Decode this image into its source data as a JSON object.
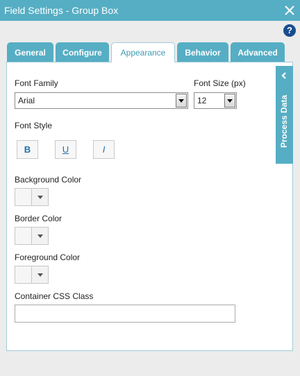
{
  "dialog": {
    "title": "Field Settings - Group Box",
    "close_icon": "close-icon",
    "help_icon": "help-icon",
    "help_glyph": "?"
  },
  "tabs": [
    {
      "label": "General",
      "active": false
    },
    {
      "label": "Configure",
      "active": false
    },
    {
      "label": "Appearance",
      "active": true
    },
    {
      "label": "Behavior",
      "active": false
    },
    {
      "label": "Advanced",
      "active": false
    }
  ],
  "appearance": {
    "font_family": {
      "label": "Font Family",
      "value": "Arial"
    },
    "font_size": {
      "label": "Font Size (px)",
      "value": "12"
    },
    "font_style": {
      "label": "Font Style",
      "bold": "B",
      "underline": "U",
      "italic": "I"
    },
    "background_color": {
      "label": "Background Color"
    },
    "border_color": {
      "label": "Border Color"
    },
    "foreground_color": {
      "label": "Foreground Color"
    },
    "container_css_class": {
      "label": "Container CSS Class",
      "value": ""
    }
  },
  "process_data": {
    "label": "Process Data",
    "icon": "chevron-left-icon"
  },
  "colors": {
    "accent": "#56aec4",
    "active_tab_text": "#3e9ab4",
    "help_icon": "#1a4d8f",
    "style_button_text": "#1e6fae"
  }
}
